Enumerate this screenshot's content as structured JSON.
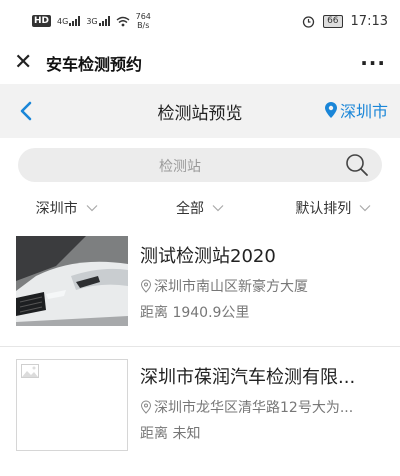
{
  "status_bar": {
    "hd": "HD",
    "net1": "4G",
    "net2": "3G",
    "speed_value": "764",
    "speed_unit": "B/s",
    "battery": "66",
    "time": "17:13"
  },
  "title_bar": {
    "title": "安车检测预约",
    "more": "···"
  },
  "nav": {
    "title": "检测站预览",
    "city": "深圳市"
  },
  "search": {
    "placeholder": "检测站"
  },
  "filters": [
    {
      "label": "深圳市"
    },
    {
      "label": "全部"
    },
    {
      "label": "默认排列"
    }
  ],
  "stations": [
    {
      "name": "测试检测站2020",
      "address": "深圳市南山区新豪方大厦",
      "distance": "距离 1940.9公里"
    },
    {
      "name": "深圳市葆润汽车检测有限...",
      "address": "深圳市龙华区清华路12号大为...",
      "distance": "距离 未知"
    }
  ],
  "colors": {
    "accent": "#1a86d8",
    "nav_bg": "#f2f2f2",
    "search_bg": "#ececec"
  }
}
